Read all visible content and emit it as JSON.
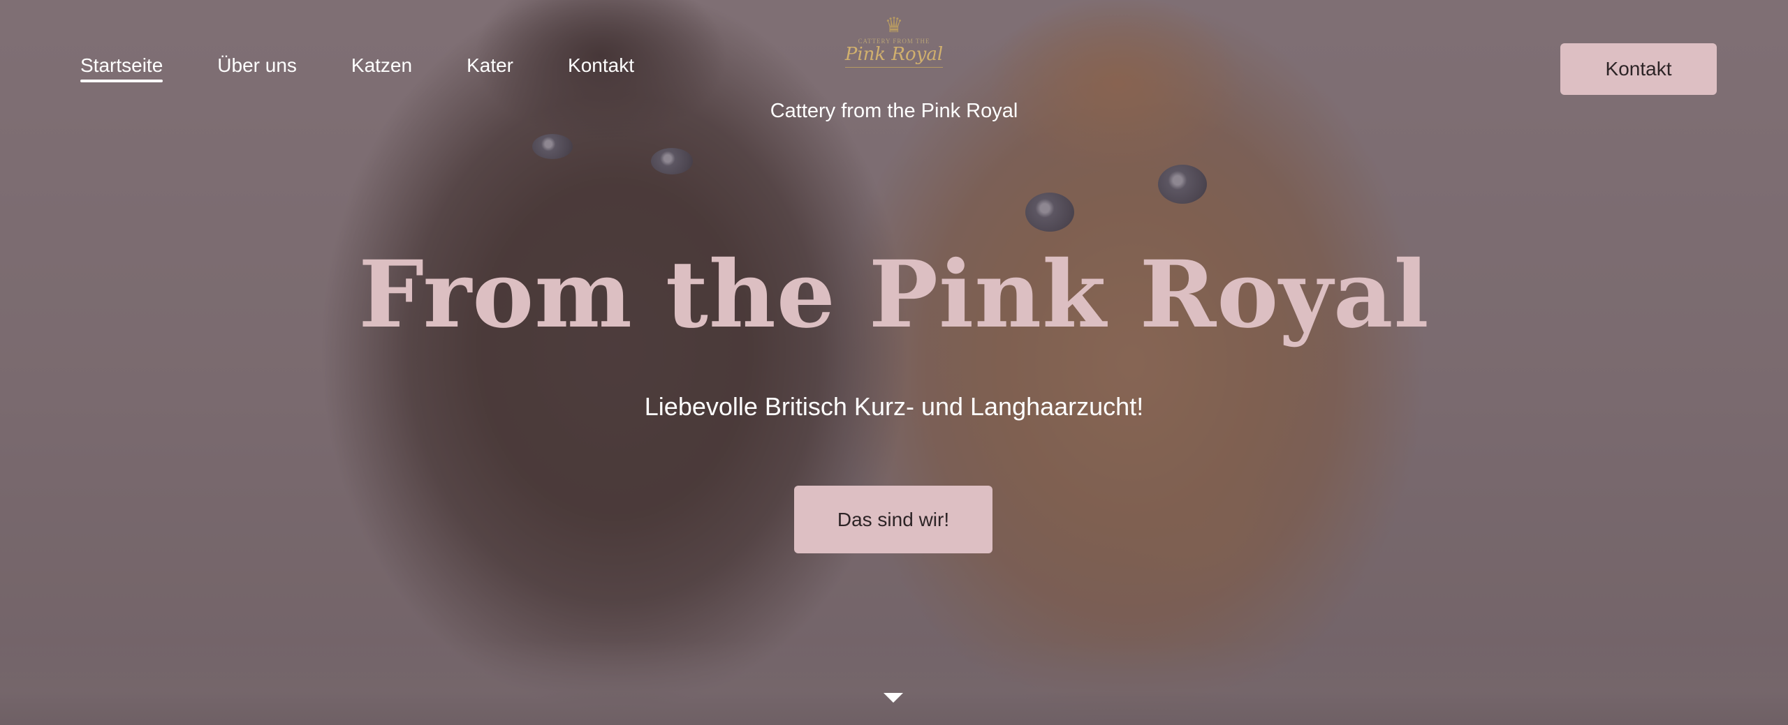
{
  "nav": {
    "items": [
      {
        "label": "Startseite",
        "active": true
      },
      {
        "label": "Über uns",
        "active": false
      },
      {
        "label": "Katzen",
        "active": false
      },
      {
        "label": "Kater",
        "active": false
      },
      {
        "label": "Kontakt",
        "active": false
      }
    ]
  },
  "logo": {
    "top_text": "CATTERY FROM THE",
    "script_text": "Pink Royal"
  },
  "header": {
    "subtitle": "Cattery from the Pink Royal",
    "contact_button": "Kontakt"
  },
  "hero": {
    "headline": "From the Pink Royal",
    "tagline": "Liebevolle Britisch Kurz- und Langhaarzucht!",
    "cta_button": "Das sind wir!"
  },
  "icons": {
    "scroll_down": "triangle-down-icon",
    "logo_crown": "crown-icon"
  },
  "colors": {
    "accent": "#ddbfc3",
    "headline": "#dcbfc2",
    "overlay": "#5c4a50",
    "logo_gold": "#b79a62"
  }
}
